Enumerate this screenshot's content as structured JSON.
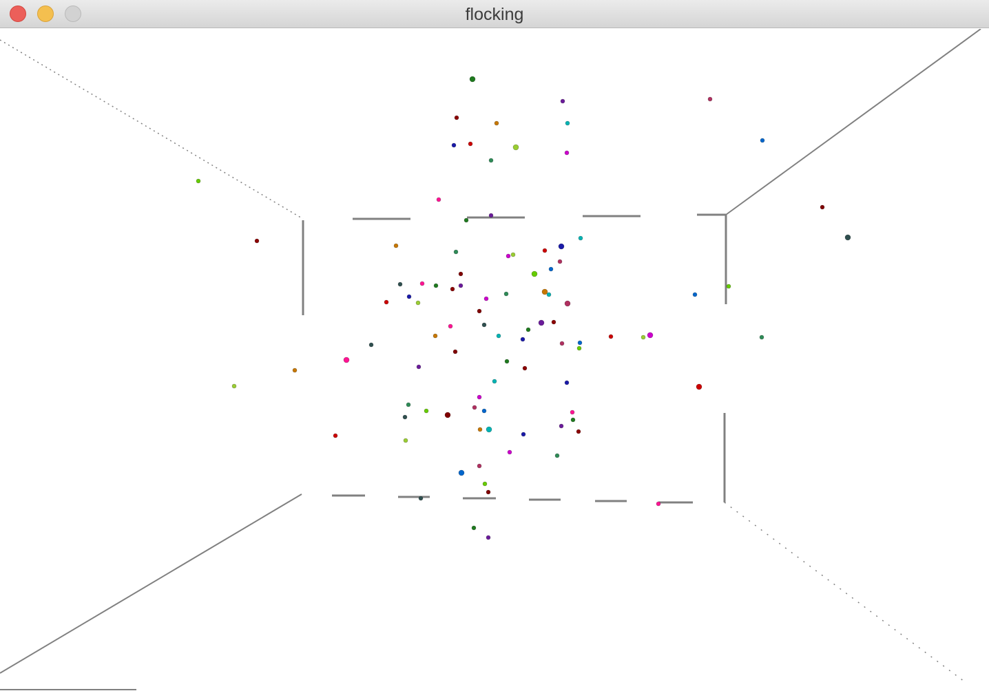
{
  "window": {
    "title": "flocking",
    "controls": [
      {
        "name": "close-button",
        "color": "#ec5f5a"
      },
      {
        "name": "minimize-button",
        "color": "#f4bf4f"
      },
      {
        "name": "zoom-button",
        "color": "#d2d2d2"
      }
    ]
  },
  "scene": {
    "background": "#ffffff",
    "wall_color": "#808080",
    "boid_colors": [
      "#1f7a1f",
      "#6a1b9a",
      "#8b0000",
      "#c77700",
      "#00b3b3",
      "#1a1aa8",
      "#cc0000",
      "#9acd32",
      "#cc00cc",
      "#2e8b57",
      "#b03060",
      "#0066cc",
      "#66cc00",
      "#800000",
      "#2f4f4f",
      "#ff1493"
    ]
  }
}
